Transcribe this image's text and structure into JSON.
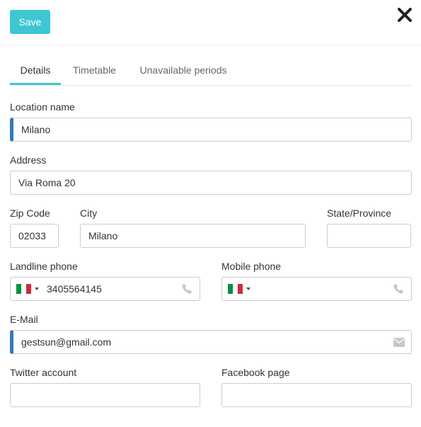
{
  "toolbar": {
    "save_label": "Save"
  },
  "tabs": [
    {
      "label": "Details",
      "active": true
    },
    {
      "label": "Timetable",
      "active": false
    },
    {
      "label": "Unavailable periods",
      "active": false
    }
  ],
  "form": {
    "location_name": {
      "label": "Location name",
      "value": "Milano"
    },
    "address": {
      "label": "Address",
      "value": "Via Roma 20"
    },
    "zip_code": {
      "label": "Zip Code",
      "value": "02033"
    },
    "city": {
      "label": "City",
      "value": "Milano"
    },
    "state_province": {
      "label": "State/Province",
      "value": ""
    },
    "landline_phone": {
      "label": "Landline phone",
      "value": "3405564145",
      "country_flag": "italy-flag"
    },
    "mobile_phone": {
      "label": "Mobile phone",
      "value": "",
      "country_flag": "italy-flag"
    },
    "email": {
      "label": "E-Mail",
      "value": "gestsun@gmail.com"
    },
    "twitter_account": {
      "label": "Twitter account",
      "value": ""
    },
    "facebook_page": {
      "label": "Facebook page",
      "value": ""
    }
  },
  "colors": {
    "accent": "#3ec6d3",
    "required_marker": "#337ab7",
    "flag_green": "#009246",
    "flag_white": "#ffffff",
    "flag_red": "#ce2b37",
    "icon_gray": "#c8c8c8"
  },
  "icons": {
    "close": "close-icon",
    "phone": "phone-icon",
    "email": "envelope-icon"
  }
}
